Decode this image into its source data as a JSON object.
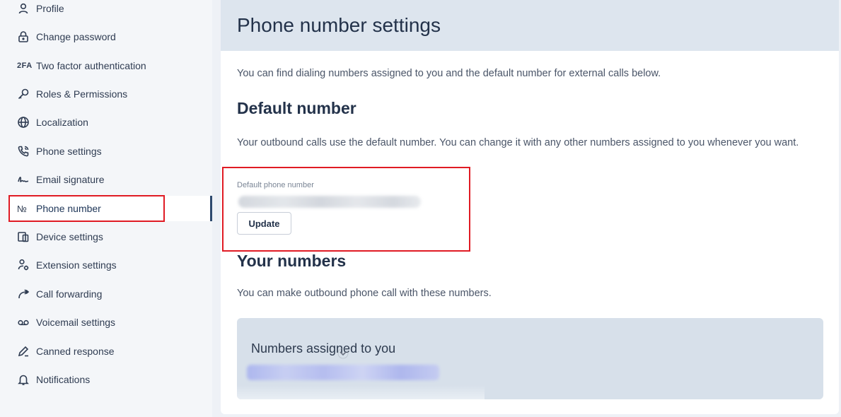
{
  "sidebar": {
    "items": [
      {
        "label": "Profile",
        "icon": "user-icon"
      },
      {
        "label": "Change password",
        "icon": "lock-icon"
      },
      {
        "label": "Two factor authentication",
        "icon": "2fa-icon",
        "icon_text": "2FA"
      },
      {
        "label": "Roles & Permissions",
        "icon": "key-icon"
      },
      {
        "label": "Localization",
        "icon": "globe-icon"
      },
      {
        "label": "Phone settings",
        "icon": "phone-icon"
      },
      {
        "label": "Email signature",
        "icon": "signature-icon"
      },
      {
        "label": "Phone number",
        "icon": "numero-icon",
        "icon_text": "№",
        "active": true
      },
      {
        "label": "Device settings",
        "icon": "devices-icon"
      },
      {
        "label": "Extension settings",
        "icon": "user-gear-icon"
      },
      {
        "label": "Call forwarding",
        "icon": "forward-arrow-icon"
      },
      {
        "label": "Voicemail settings",
        "icon": "voicemail-icon"
      },
      {
        "label": "Canned response",
        "icon": "pen-icon"
      },
      {
        "label": "Notifications",
        "icon": "bell-icon"
      }
    ]
  },
  "main": {
    "title": "Phone number settings",
    "intro": "You can find dialing numbers assigned to you and the default number for external calls below.",
    "default_section": {
      "heading": "Default number",
      "description": "Your outbound calls use the default number. You can change it with any other numbers assigned to you whenever you want.",
      "field_label": "Default phone number",
      "update_label": "Update"
    },
    "your_numbers": {
      "heading": "Your numbers",
      "description": "You can make outbound phone call with these numbers.",
      "panel_title": "Numbers assigned to you"
    }
  },
  "colors": {
    "highlight": "#e01b24",
    "header_bg": "#dde5ee",
    "active_bar": "#2e4a6e",
    "panel_bg": "#d7e0ea"
  }
}
